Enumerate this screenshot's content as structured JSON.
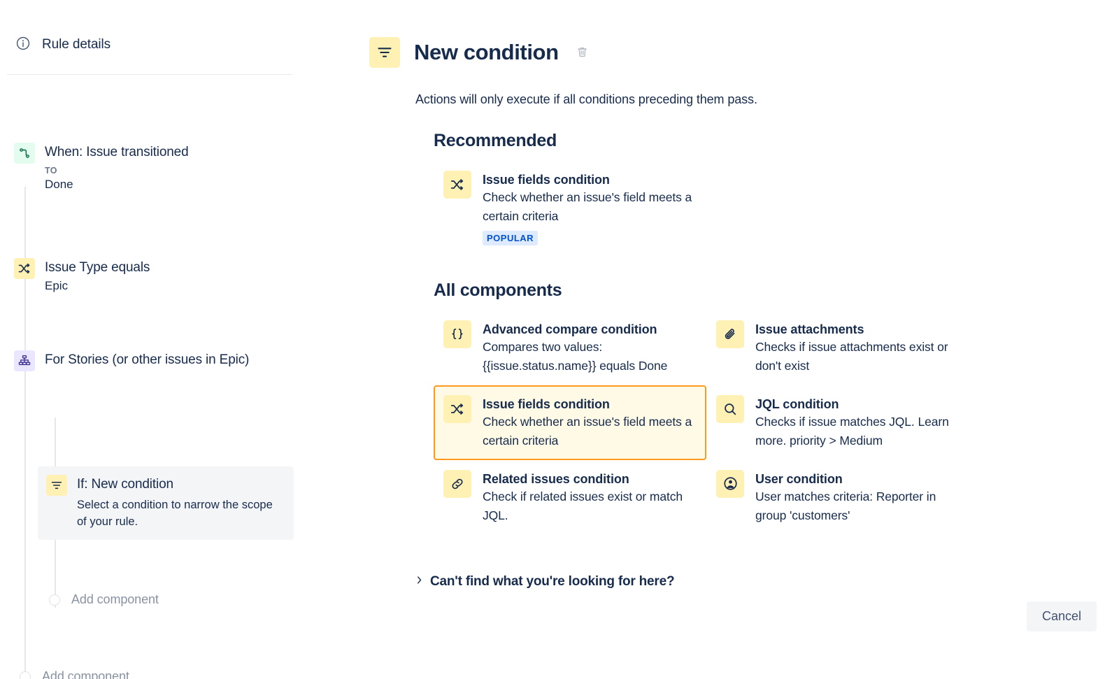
{
  "sidebar": {
    "rule_details": {
      "label": "Rule details",
      "icon": "info-circle-icon"
    },
    "nodes": [
      {
        "title": "When: Issue transitioned",
        "sub_label": "TO",
        "sub_value": "Done",
        "icon": "transition-icon",
        "icon_color": "#E3FCEF"
      },
      {
        "title": "Issue Type equals",
        "sub_value": "Epic",
        "icon": "shuffle-icon",
        "icon_color": "#FFF0B3"
      },
      {
        "title": "For Stories (or other issues in Epic)",
        "icon": "branch-hierarchy-icon",
        "icon_color": "#EAE6FF"
      }
    ],
    "selected_node": {
      "title": "If: New condition",
      "description": "Select a condition to narrow the scope of your rule.",
      "icon": "filter-icon",
      "icon_color": "#FFF0B3"
    },
    "add_component_branch": "Add component",
    "add_component_root": "Add component"
  },
  "main": {
    "header": {
      "title": "New condition",
      "icon": "filter-icon",
      "delete_icon": "trash-icon"
    },
    "subtitle": "Actions will only execute if all conditions preceding them pass.",
    "recommended": {
      "title": "Recommended",
      "items": [
        {
          "title": "Issue fields condition",
          "description": "Check whether an issue's field meets a certain criteria",
          "badge": "POPULAR",
          "icon": "shuffle-icon",
          "highlighted": false
        }
      ]
    },
    "all_components": {
      "title": "All components",
      "items": [
        {
          "title": "Advanced compare condition",
          "description": "Compares two values: {{issue.status.name}} equals Done",
          "icon": "braces-icon",
          "highlighted": false
        },
        {
          "title": "Issue attachments",
          "description": "Checks if issue attachments exist or don't exist",
          "icon": "paperclip-icon",
          "highlighted": false
        },
        {
          "title": "Issue fields condition",
          "description": "Check whether an issue's field meets a certain criteria",
          "icon": "shuffle-icon",
          "highlighted": true
        },
        {
          "title": "JQL condition",
          "description": "Checks if issue matches JQL. Learn more. priority > Medium",
          "icon": "search-icon",
          "highlighted": false
        },
        {
          "title": "Related issues condition",
          "description": "Check if related issues exist or match JQL.",
          "icon": "link-icon",
          "highlighted": false
        },
        {
          "title": "User condition",
          "description": "User matches criteria: Reporter in group 'customers'",
          "icon": "user-circle-icon",
          "highlighted": false
        }
      ]
    },
    "cant_find": {
      "label": "Can't find what you're looking for here?",
      "icon": "chevron-right-icon"
    },
    "cancel_label": "Cancel"
  },
  "colors": {
    "accent_highlight_border": "#FF991F",
    "accent_highlight_bg": "#FFFAE6",
    "icon_yellow": "#FFF0B3",
    "icon_green": "#E3FCEF",
    "icon_purple": "#EAE6FF",
    "badge_bg": "#DEEBFF",
    "badge_text": "#0052CC",
    "text_primary": "#172B4D",
    "text_muted": "#6B778C"
  }
}
